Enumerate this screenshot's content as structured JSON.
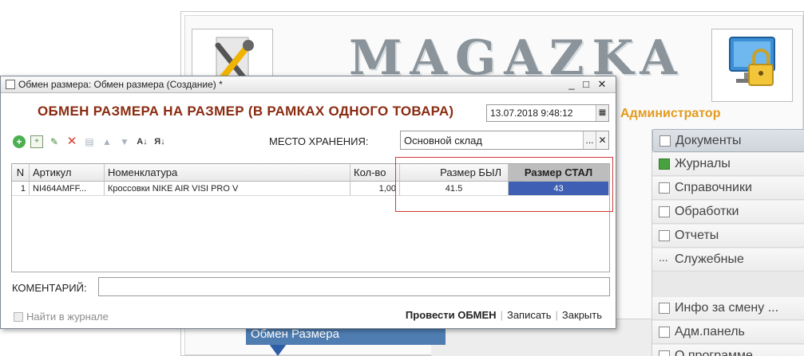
{
  "background_app": {
    "brand": "MAGAZKA",
    "user_role": "Администратор",
    "menu": [
      {
        "label": "Документы",
        "icon": "document-icon"
      },
      {
        "label": "Журналы",
        "icon": "journal-icon"
      },
      {
        "label": "Справочники",
        "icon": "catalog-icon"
      },
      {
        "label": "Обработки",
        "icon": "processing-icon"
      },
      {
        "label": "Отчеты",
        "icon": "report-icon"
      },
      {
        "label": "Служебные",
        "icon": "dots-icon"
      },
      {
        "label": "Инфо за смену ...",
        "icon": "info-icon"
      },
      {
        "label": "Адм.панель",
        "icon": "admin-icon"
      },
      {
        "label": "О программе",
        "icon": "about-icon"
      }
    ],
    "active_tab": "Обмен Размера"
  },
  "dialog": {
    "title": "Обмен размера: Обмен размера (Создание) *",
    "heading": "ОБМЕН РАЗМЕРА НА РАЗМЕР (В РАМКАХ ОДНОГО ТОВАРА)",
    "date": "13.07.2018  9:48:12",
    "storage_label": "МЕСТО ХРАНЕНИЯ:",
    "storage_value": "Основной склад",
    "table": {
      "headers": [
        "N",
        "Артикул",
        "Номенклатура",
        "Кол-во",
        "Размер БЫЛ",
        "Размер СТАЛ"
      ],
      "rows": [
        [
          "1",
          "NI464AMFF...",
          "Кроссовки NIKE AIR VISI PRO V",
          "1,00",
          "41.5",
          "43"
        ]
      ]
    },
    "comment_label": "КОМЕНТАРИЙ:",
    "comment_value": "",
    "find_in_journal": "Найти в журнале",
    "actions": {
      "post": "Провести ОБМЕН",
      "save": "Записать",
      "close": "Закрыть"
    }
  },
  "colors": {
    "heading": "#8a2c12",
    "selected_cell": "#3e5fb3",
    "highlight_box": "#d13a3a",
    "role_label": "#e39b1e"
  }
}
